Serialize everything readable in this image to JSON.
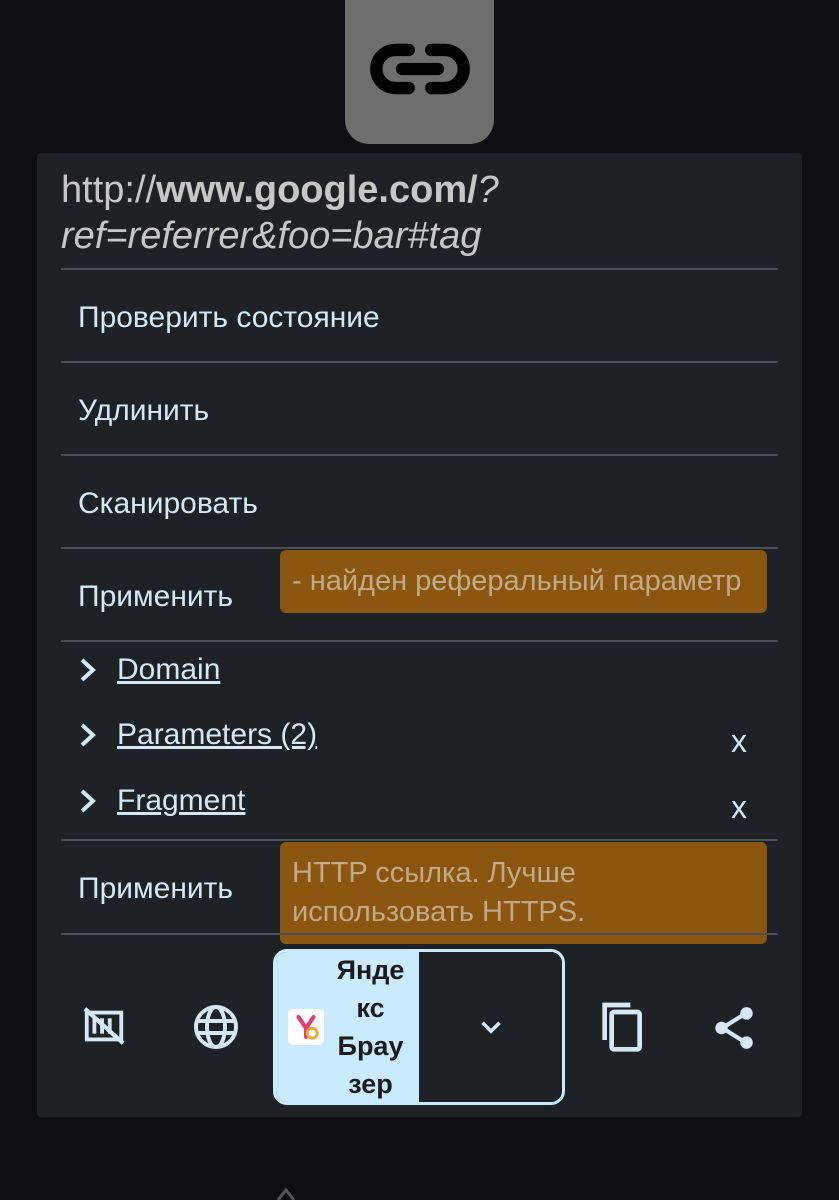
{
  "url": {
    "scheme": "http://",
    "host": "www.google.com/",
    "rest": "?ref=referrer&foo=bar#tag"
  },
  "actions": {
    "check_status": "Проверить состояние",
    "unshorten": "Удлинить",
    "scan": "Сканировать"
  },
  "referrer_module": {
    "apply_label": "Применить",
    "warning": "- найден реферальный параметр"
  },
  "tree": {
    "domain": "Domain",
    "parameters": "Parameters (2)",
    "fragment": "Fragment",
    "remove_label": "x"
  },
  "http_module": {
    "apply_label": "Применить",
    "warning": "HTTP ссылка. Лучше использовать HTTPS."
  },
  "toolbar": {
    "browser_name": "Янде\nкс\nБрау\nзер"
  },
  "icons": {
    "app": "link-icon",
    "toolbar": [
      "no-ads-icon",
      "globe-icon",
      "yandex-browser-icon",
      "chevron-down-icon",
      "copy-icon",
      "share-icon"
    ]
  },
  "colors": {
    "warning_bg": "#8a5610",
    "accent": "#c9eaff"
  }
}
